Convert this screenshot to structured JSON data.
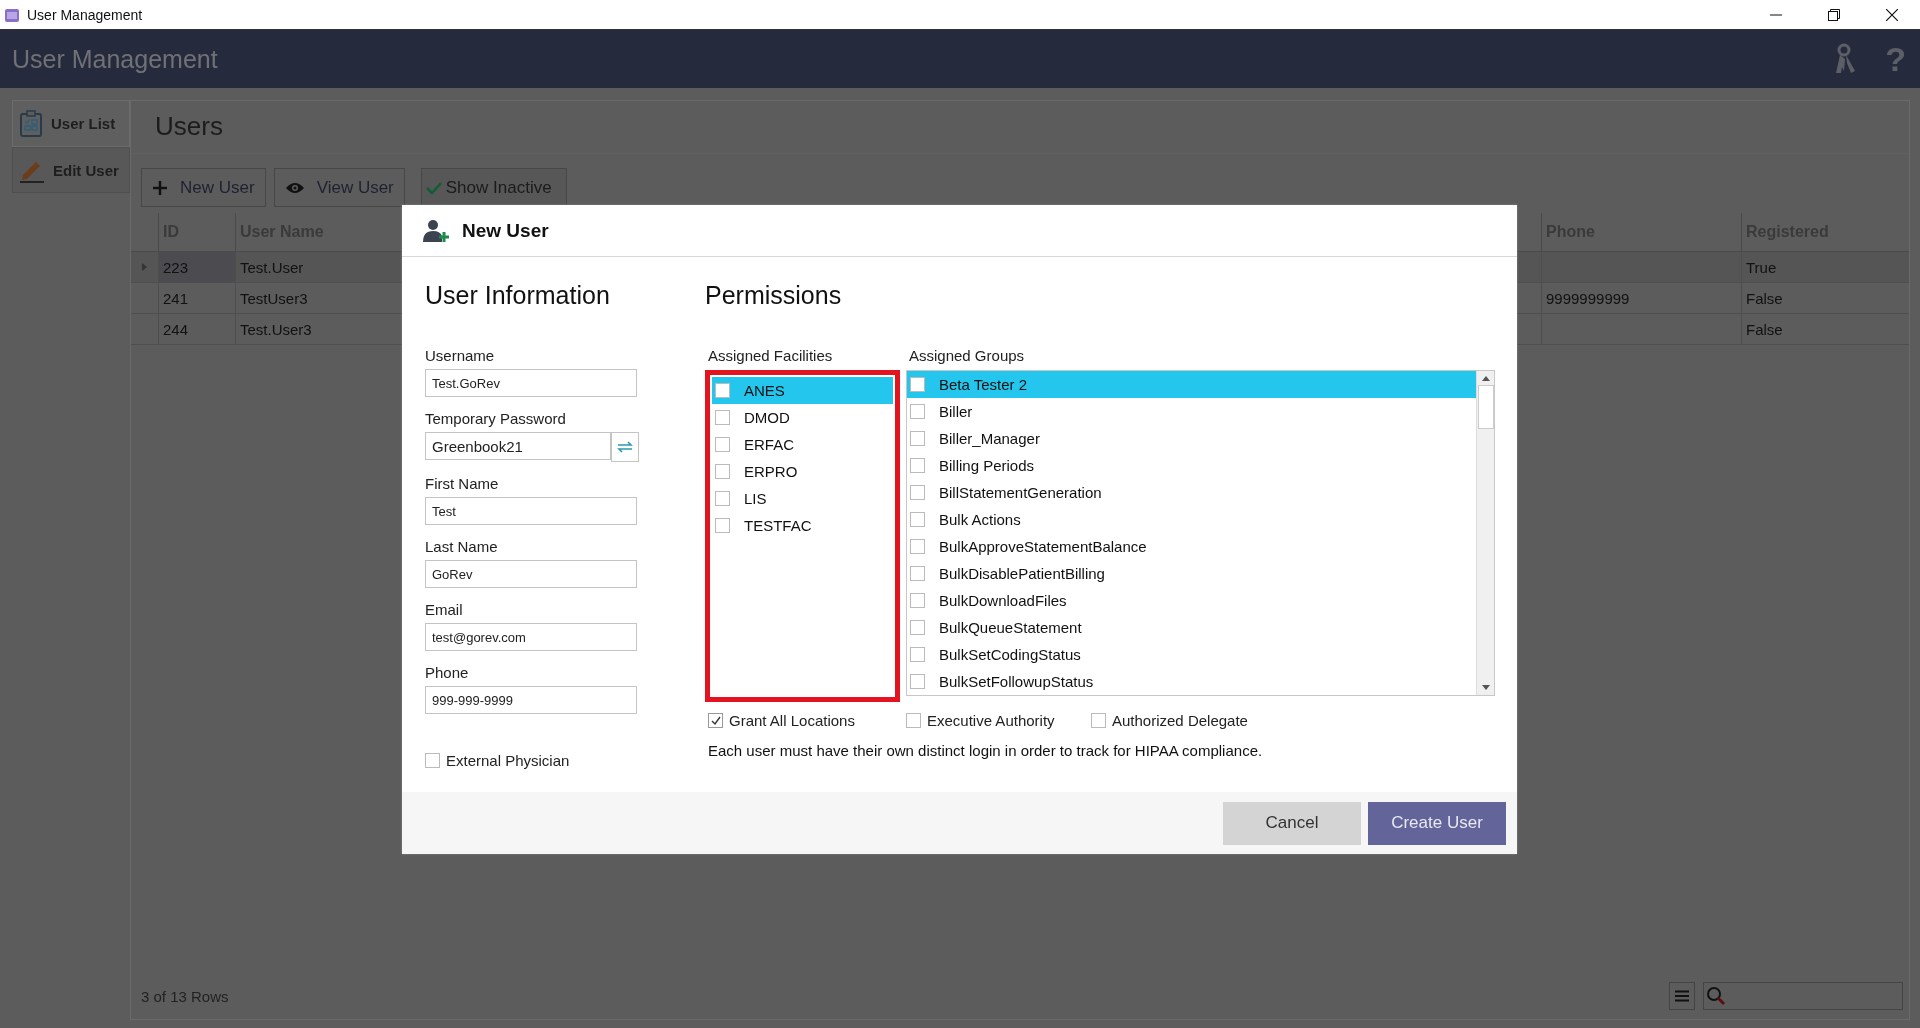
{
  "window": {
    "title": "User Management"
  },
  "header": {
    "title": "User Management",
    "help": "?"
  },
  "sidebar": {
    "tabs": [
      {
        "label": "User List",
        "kind": "list",
        "selected": true
      },
      {
        "label": "Edit User",
        "kind": "edit",
        "selected": false
      }
    ]
  },
  "users": {
    "heading": "Users",
    "toolbar": [
      {
        "label": "New User",
        "kind": "add"
      },
      {
        "label": "View User",
        "kind": "view"
      },
      {
        "label": "Show Inactive",
        "kind": "toggle",
        "checked": true
      }
    ],
    "table": {
      "columns": [
        "ID",
        "User Name",
        "Phone",
        "Registered"
      ],
      "rows": [
        {
          "id": "223",
          "user_name": "Test.User",
          "registered": "True",
          "selected": true
        },
        {
          "id": "241",
          "user_name": "TestUser3",
          "phone": "9999999999",
          "registered": "False",
          "selected": false
        },
        {
          "id": "244",
          "user_name": "Test.User3",
          "registered": "False",
          "selected": false
        }
      ]
    },
    "row_count": "3 of 13 Rows"
  },
  "dialog": {
    "title": "New User",
    "user_information": {
      "heading": "User Information",
      "fields": [
        {
          "label": "Username",
          "value": "Test.GoRev",
          "kind": "text"
        },
        {
          "label": "Temporary Password",
          "value": "Greenbook21",
          "kind": "password"
        },
        {
          "label": "First Name",
          "value": "Test",
          "kind": "text"
        },
        {
          "label": "Last Name",
          "value": "GoRev",
          "kind": "text"
        },
        {
          "label": "Email",
          "value": "test@gorev.com",
          "kind": "text"
        },
        {
          "label": "Phone",
          "value": "999-999-9999",
          "kind": "text"
        }
      ],
      "external_physician": {
        "label": "External Physician",
        "checked": false
      }
    },
    "permissions": {
      "heading": "Permissions",
      "facilities": {
        "label": "Assigned Facilities",
        "highlighted": true,
        "items": [
          {
            "label": "ANES",
            "checked": false,
            "selected": true
          },
          {
            "label": "DMOD",
            "checked": false,
            "selected": false
          },
          {
            "label": "ERFAC",
            "checked": false,
            "selected": false
          },
          {
            "label": "ERPRO",
            "checked": false,
            "selected": false
          },
          {
            "label": "LIS",
            "checked": false,
            "selected": false
          },
          {
            "label": "TESTFAC",
            "checked": false,
            "selected": false
          }
        ]
      },
      "groups": {
        "label": "Assigned Groups",
        "items": [
          {
            "label": "Beta Tester 2",
            "checked": false,
            "selected": true
          },
          {
            "label": "Biller",
            "checked": false,
            "selected": false
          },
          {
            "label": "Biller_Manager",
            "checked": false,
            "selected": false
          },
          {
            "label": "Billing Periods",
            "checked": false,
            "selected": false
          },
          {
            "label": "BillStatementGeneration",
            "checked": false,
            "selected": false
          },
          {
            "label": "Bulk Actions",
            "checked": false,
            "selected": false
          },
          {
            "label": "BulkApproveStatementBalance",
            "checked": false,
            "selected": false
          },
          {
            "label": "BulkDisablePatientBilling",
            "checked": false,
            "selected": false
          },
          {
            "label": "BulkDownloadFiles",
            "checked": false,
            "selected": false
          },
          {
            "label": "BulkQueueStatement",
            "checked": false,
            "selected": false
          },
          {
            "label": "BulkSetCodingStatus",
            "checked": false,
            "selected": false
          },
          {
            "label": "BulkSetFollowupStatus",
            "checked": false,
            "selected": false
          }
        ]
      },
      "options": [
        {
          "label": "Grant All Locations",
          "checked": true
        },
        {
          "label": "Executive Authority",
          "checked": false
        },
        {
          "label": "Authorized Delegate",
          "checked": false
        }
      ],
      "note": "Each user must have their own distinct login in order to track for HIPAA compliance."
    },
    "buttons": [
      {
        "label": "Cancel",
        "kind": "secondary"
      },
      {
        "label": "Create User",
        "kind": "primary"
      }
    ]
  }
}
